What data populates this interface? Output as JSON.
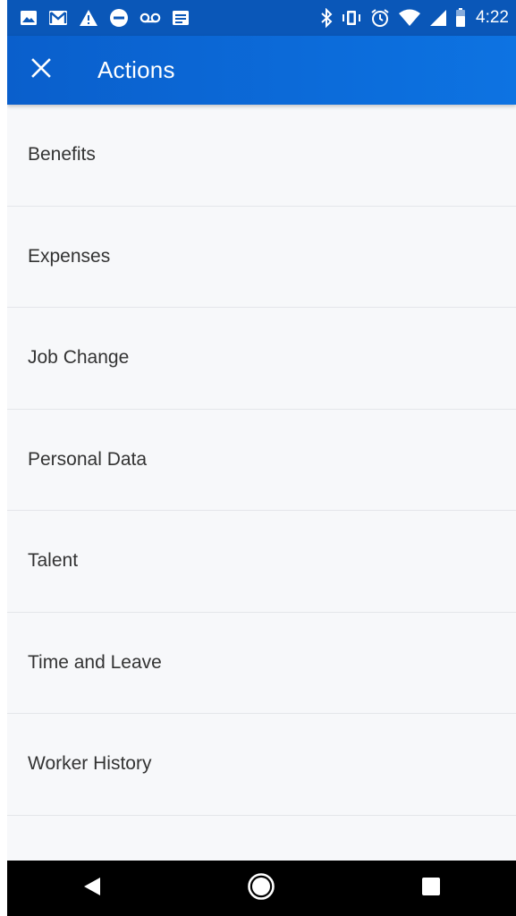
{
  "status_bar": {
    "time": "4:22",
    "left_icons": [
      "image-icon",
      "gmail-icon",
      "warning-icon",
      "do-not-disturb-icon",
      "voicemail-icon",
      "message-icon"
    ],
    "right_icons": [
      "bluetooth-icon",
      "vibrate-icon",
      "alarm-icon",
      "wifi-icon",
      "cellular-signal-icon",
      "battery-icon"
    ]
  },
  "app_bar": {
    "title": "Actions",
    "close_icon": "close-icon"
  },
  "actions": [
    {
      "label": "Benefits"
    },
    {
      "label": "Expenses"
    },
    {
      "label": "Job Change"
    },
    {
      "label": "Personal Data"
    },
    {
      "label": "Talent"
    },
    {
      "label": "Time and Leave"
    },
    {
      "label": "Worker History"
    }
  ],
  "nav_bar": {
    "buttons": [
      "back-icon",
      "home-icon",
      "recents-icon"
    ]
  },
  "colors": {
    "status_bar": "#0a57b8",
    "app_bar": "#0d6ad8",
    "list_background": "#f7f8fa",
    "divider": "#e4e6ea",
    "item_text": "#333333",
    "nav_bar": "#000000"
  }
}
